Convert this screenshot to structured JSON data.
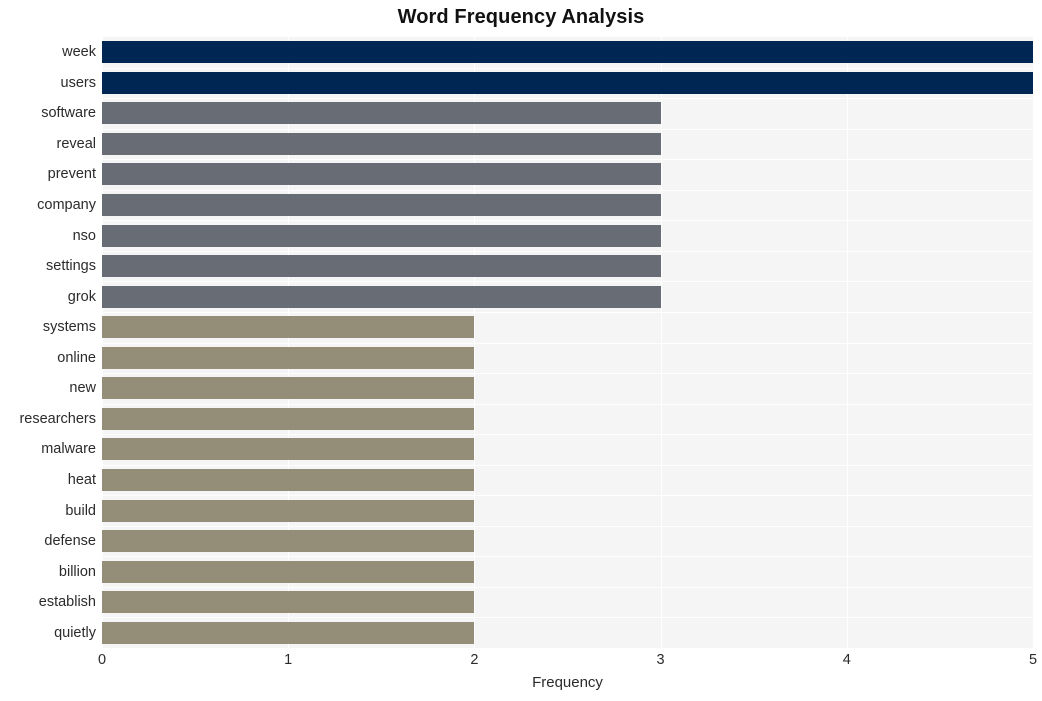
{
  "chart_data": {
    "type": "bar",
    "orientation": "horizontal",
    "title": "Word Frequency Analysis",
    "xlabel": "Frequency",
    "ylabel": "",
    "xlim": [
      0,
      5
    ],
    "xticks": [
      "0",
      "1",
      "2",
      "3",
      "4",
      "5"
    ],
    "xtick_values": [
      0,
      1,
      2,
      3,
      4,
      5
    ],
    "grid": true,
    "legend": "none",
    "categories": [
      "week",
      "users",
      "software",
      "reveal",
      "prevent",
      "company",
      "nso",
      "settings",
      "grok",
      "systems",
      "online",
      "new",
      "researchers",
      "malware",
      "heat",
      "build",
      "defense",
      "billion",
      "establish",
      "quietly"
    ],
    "values": [
      5,
      5,
      3,
      3,
      3,
      3,
      3,
      3,
      3,
      2,
      2,
      2,
      2,
      2,
      2,
      2,
      2,
      2,
      2,
      2
    ],
    "bar_colors": [
      "#002654",
      "#002654",
      "#686c74",
      "#686c74",
      "#686c74",
      "#686c74",
      "#686c74",
      "#686c74",
      "#686c74",
      "#948d77",
      "#948d77",
      "#948d77",
      "#948d77",
      "#948d77",
      "#948d77",
      "#948d77",
      "#948d77",
      "#948d77",
      "#948d77",
      "#948d77"
    ],
    "palette": {
      "high": "#002654",
      "medium": "#686c74",
      "low": "#948d77",
      "plot_background": "#f5f5f6",
      "gridline": "#ffffff",
      "page_background": "#ffffff",
      "text": "#2b2b2b"
    }
  }
}
